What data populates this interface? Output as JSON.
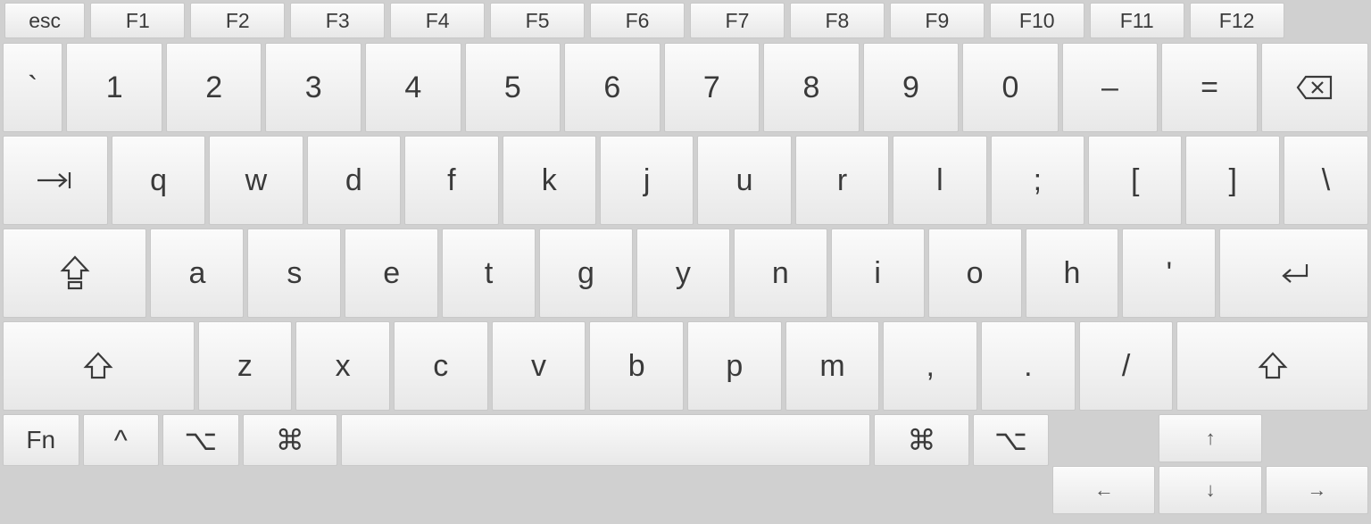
{
  "fn_row": {
    "esc": "esc",
    "keys": [
      "F1",
      "F2",
      "F3",
      "F4",
      "F5",
      "F6",
      "F7",
      "F8",
      "F9",
      "F10",
      "F11",
      "F12"
    ]
  },
  "num_row": {
    "backtick": "`",
    "keys": [
      "1",
      "2",
      "3",
      "4",
      "5",
      "6",
      "7",
      "8",
      "9",
      "0",
      "–",
      "="
    ],
    "backspace": "⌫"
  },
  "q_row": {
    "tab": "⇥",
    "keys": [
      "q",
      "w",
      "d",
      "f",
      "k",
      "j",
      "u",
      "r",
      "l",
      ";",
      "[",
      "]"
    ],
    "backslash": "\\"
  },
  "a_row": {
    "caps": "⇪",
    "keys": [
      "a",
      "s",
      "e",
      "t",
      "g",
      "y",
      "n",
      "i",
      "o",
      "h",
      "'"
    ],
    "enter": "↩"
  },
  "z_row": {
    "shift_l": "⇧",
    "keys": [
      "z",
      "x",
      "c",
      "v",
      "b",
      "p",
      "m",
      ",",
      ".",
      "/"
    ],
    "shift_r": "⇧"
  },
  "bottom_row": {
    "fn": "Fn",
    "ctrl": "^",
    "opt_l": "⌥",
    "cmd_l": "⌘",
    "space": "",
    "cmd_r": "⌘",
    "opt_r": "⌥",
    "arrows": {
      "up": "↑",
      "left": "←",
      "down": "↓",
      "right": "→"
    }
  }
}
